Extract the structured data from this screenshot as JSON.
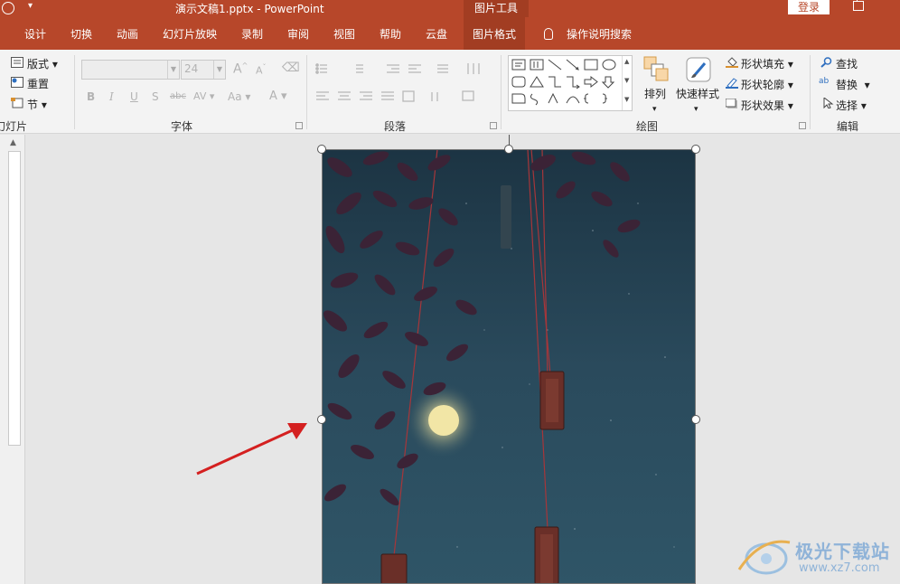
{
  "titlebar": {
    "title": "演示文稿1.pptx  -  PowerPoint",
    "context_tools": "图片工具",
    "login": "登录"
  },
  "tabs": [
    {
      "label": "设计"
    },
    {
      "label": "切换"
    },
    {
      "label": "动画"
    },
    {
      "label": "幻灯片放映"
    },
    {
      "label": "录制"
    },
    {
      "label": "审阅"
    },
    {
      "label": "视图"
    },
    {
      "label": "帮助"
    },
    {
      "label": "云盘"
    },
    {
      "label": "图片格式",
      "active": true
    },
    {
      "label": "操作说明搜索"
    }
  ],
  "ribbon": {
    "slides": {
      "layout": "版式",
      "reset": "重置",
      "section": "节",
      "group_label": "幻灯片"
    },
    "font": {
      "font_name": "",
      "font_size": "24",
      "bold": "B",
      "italic": "I",
      "underline": "U",
      "shadow": "S",
      "strike": "abc",
      "spacing": "AV",
      "case": "Aa",
      "color": "A",
      "grow": "A",
      "shrink": "A",
      "group_label": "字体"
    },
    "paragraph": {
      "group_label": "段落"
    },
    "drawing": {
      "arrange": "排列",
      "quick_styles": "快速样式",
      "shape_fill": "形状填充",
      "shape_outline": "形状轮廓",
      "shape_effects": "形状效果",
      "group_label": "绘图"
    },
    "editing": {
      "find": "查找",
      "replace": "替换",
      "select": "选择",
      "group_label": "编辑"
    }
  },
  "watermark": {
    "title": "极光下载站",
    "url": "www.xz7.com"
  },
  "colors": {
    "brand": "#b7472a",
    "brand_dark": "#a23d22",
    "arrow": "#d42020"
  }
}
